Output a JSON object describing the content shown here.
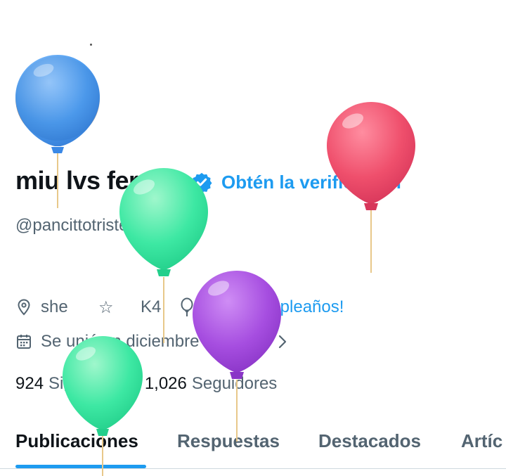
{
  "profile": {
    "display_name": "miu lvs fer<3",
    "get_verified_label": "Obtén la verificación",
    "handle": "@pancittotriste",
    "pronouns": "she",
    "star_text": "☆",
    "k4_text": "K4",
    "birthday_text": "¡Feliz cumpleaños!",
    "joined_text": "Se unió en diciembre de 2023",
    "following_count": "924",
    "following_label": "Siguiendo",
    "followers_count": "1,026",
    "followers_label": "Seguidores"
  },
  "tabs": [
    {
      "label": "Publicaciones",
      "active": true
    },
    {
      "label": "Respuestas",
      "active": false
    },
    {
      "label": "Destacados",
      "active": false
    },
    {
      "label": "Artíc",
      "active": false
    }
  ],
  "colors": {
    "accent": "#1d9bf0",
    "text_primary": "#0f1419",
    "text_secondary": "#536471",
    "balloon_blue": "#4a9ff0",
    "balloon_red": "#ef4f6c",
    "balloon_green": "#3de8a3",
    "balloon_purple": "#a64ee0"
  },
  "icons": {
    "location": "location-pin-icon",
    "birthday": "balloon-icon",
    "calendar": "calendar-icon",
    "chevron": "chevron-right-icon",
    "verified": "verified-badge-icon"
  }
}
